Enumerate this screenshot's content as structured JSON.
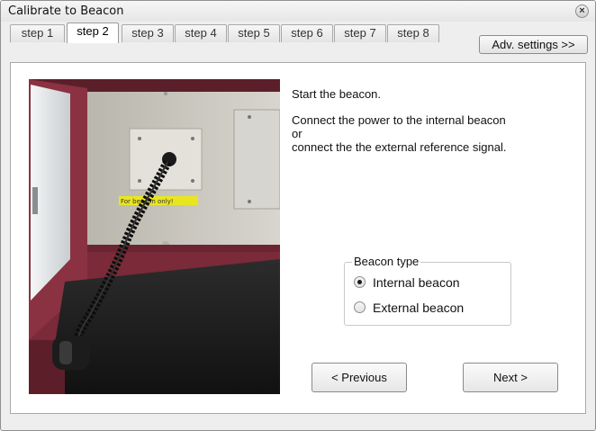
{
  "window": {
    "title": "Calibrate to Beacon",
    "close_symbol": "×"
  },
  "tabs": [
    {
      "label": "step 1",
      "active": false
    },
    {
      "label": "step 2",
      "active": true
    },
    {
      "label": "step 3",
      "active": false
    },
    {
      "label": "step 4",
      "active": false
    },
    {
      "label": "step 5",
      "active": false
    },
    {
      "label": "step 6",
      "active": false
    },
    {
      "label": "step 7",
      "active": false
    },
    {
      "label": "step 8",
      "active": false
    }
  ],
  "adv_settings_label": "Adv. settings >>",
  "photo": {
    "label_text": "For beacon only!"
  },
  "instructions": {
    "line1": "Start the beacon.",
    "line2": "Connect the power to the internal beacon",
    "line3": "or",
    "line4": "connect the the external reference signal."
  },
  "beacon_type": {
    "label": "Beacon type",
    "options": [
      {
        "label": "Internal beacon",
        "checked": true
      },
      {
        "label": "External beacon",
        "checked": false
      }
    ]
  },
  "nav": {
    "previous_label": "< Previous",
    "next_label": "Next >"
  }
}
